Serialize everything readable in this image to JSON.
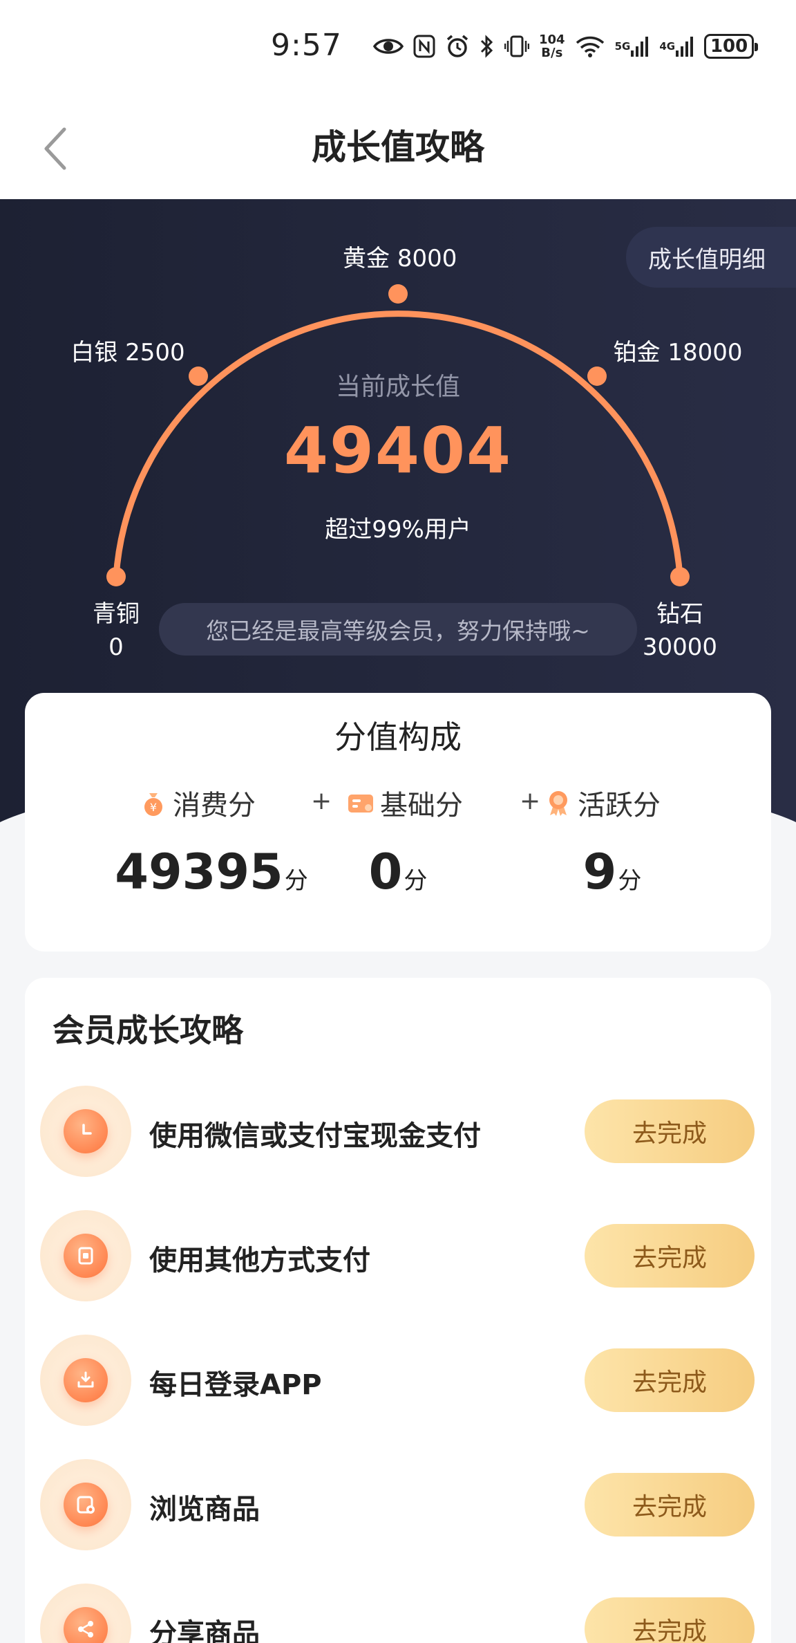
{
  "status_bar": {
    "time": "9:57",
    "speed_value": "104",
    "speed_unit": "B/s",
    "net1": "5G",
    "net2": "4G",
    "battery": "100",
    "icons": [
      "eye-icon",
      "nfc-icon",
      "alarm-icon",
      "bluetooth-icon",
      "vibrate-icon",
      "wifi-icon",
      "signal-icon",
      "battery-icon"
    ]
  },
  "header": {
    "title": "成长值攻略",
    "back_icon": "chevron-left-icon"
  },
  "hero": {
    "detail_button": "成长值明细",
    "current_label": "当前成长值",
    "current_value": "49404",
    "rank_text": "超过99%用户",
    "notice": "您已经是最高等级会员，努力保持哦~",
    "gauge_color": "#ff935c",
    "tiers": [
      {
        "name": "青铜",
        "threshold": "0"
      },
      {
        "name": "白银",
        "threshold": "2500"
      },
      {
        "name": "黄金",
        "threshold": "8000"
      },
      {
        "name": "铂金",
        "threshold": "18000"
      },
      {
        "name": "钻石",
        "threshold": "30000"
      }
    ]
  },
  "score": {
    "title": "分值构成",
    "plus": "+",
    "unit": "分",
    "items": [
      {
        "label": "消费分",
        "value": "49395",
        "icon": "money-bag-icon"
      },
      {
        "label": "基础分",
        "value": "0",
        "icon": "card-icon"
      },
      {
        "label": "活跃分",
        "value": "9",
        "icon": "award-icon"
      }
    ]
  },
  "tasks": {
    "title": "会员成长攻略",
    "button_label": "去完成",
    "accent": "#f6cd81",
    "items": [
      {
        "label": "使用微信或支付宝现金支付",
        "icon": "clock-icon"
      },
      {
        "label": "使用其他方式支付",
        "icon": "wallet-icon"
      },
      {
        "label": "每日登录APP",
        "icon": "download-icon"
      },
      {
        "label": "浏览商品",
        "icon": "browse-icon"
      },
      {
        "label": "分享商品",
        "icon": "share-icon"
      }
    ]
  }
}
